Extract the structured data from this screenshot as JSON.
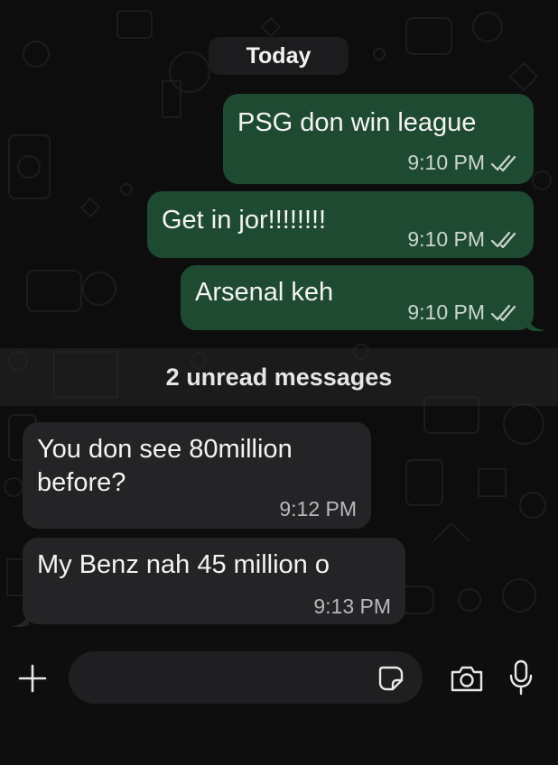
{
  "date_label": "Today",
  "messages": [
    {
      "direction": "outgoing",
      "text": "PSG don win league",
      "time": "9:10 PM",
      "status": "read"
    },
    {
      "direction": "outgoing",
      "text": "Get in jor!!!!!!!!",
      "time": "9:10 PM",
      "status": "read"
    },
    {
      "direction": "outgoing",
      "text": "Arsenal keh",
      "time": "9:10 PM",
      "status": "read"
    },
    {
      "direction": "incoming",
      "text_line1": "You don see 80million",
      "text_line2": "before?",
      "time": "9:12 PM"
    },
    {
      "direction": "incoming",
      "text": "My Benz nah 45 million o",
      "time": "9:13 PM"
    }
  ],
  "unread_label": "2 unread messages",
  "composer": {
    "placeholder": ""
  },
  "icons": {
    "add": "plus-icon",
    "sticker": "sticker-icon",
    "camera": "camera-icon",
    "mic": "microphone-icon",
    "read_receipt": "double-check-icon"
  },
  "colors": {
    "outgoing_bubble": "#1f4a32",
    "incoming_bubble": "#242426",
    "background": "#0d0d0d"
  }
}
